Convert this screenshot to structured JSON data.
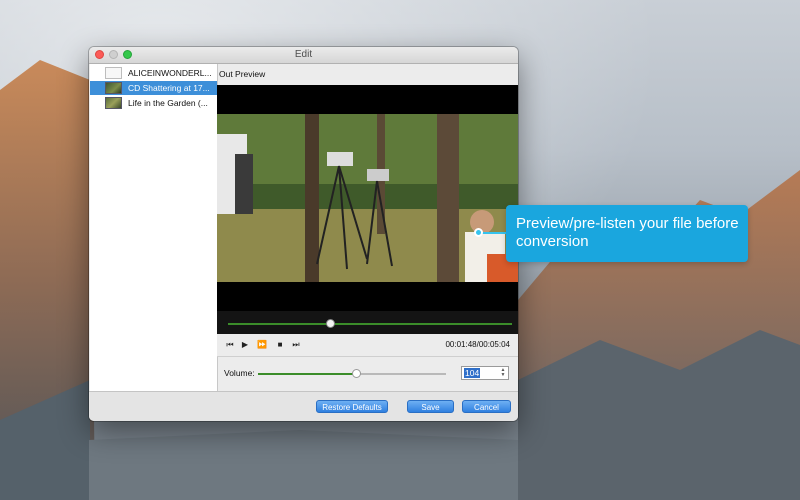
{
  "window": {
    "title": "Edit"
  },
  "files": [
    {
      "name": "ALICEINWONDERL...",
      "kind": "audio",
      "selected": false
    },
    {
      "name": "CD Shattering at 17...",
      "kind": "video",
      "selected": true
    },
    {
      "name": "Life in the Garden (...",
      "kind": "video",
      "selected": false
    }
  ],
  "preview": {
    "label": "Out Preview",
    "progress_percent": 36
  },
  "playback": {
    "time": "00:01:48/00:05:04",
    "icons": [
      "skip-start-icon",
      "play-icon",
      "fast-forward-icon",
      "stop-icon",
      "skip-end-icon"
    ]
  },
  "volume": {
    "label": "Volume:",
    "value": "104",
    "level_percent": 52
  },
  "buttons": {
    "restore": "Restore Defaults",
    "save": "Save",
    "cancel": "Cancel"
  },
  "callout": {
    "text": "Preview/pre-listen your file before conversion"
  },
  "colors": {
    "accent": "#3d8fd9",
    "callout": "#1aa6de",
    "progress": "#3b8d2a"
  }
}
